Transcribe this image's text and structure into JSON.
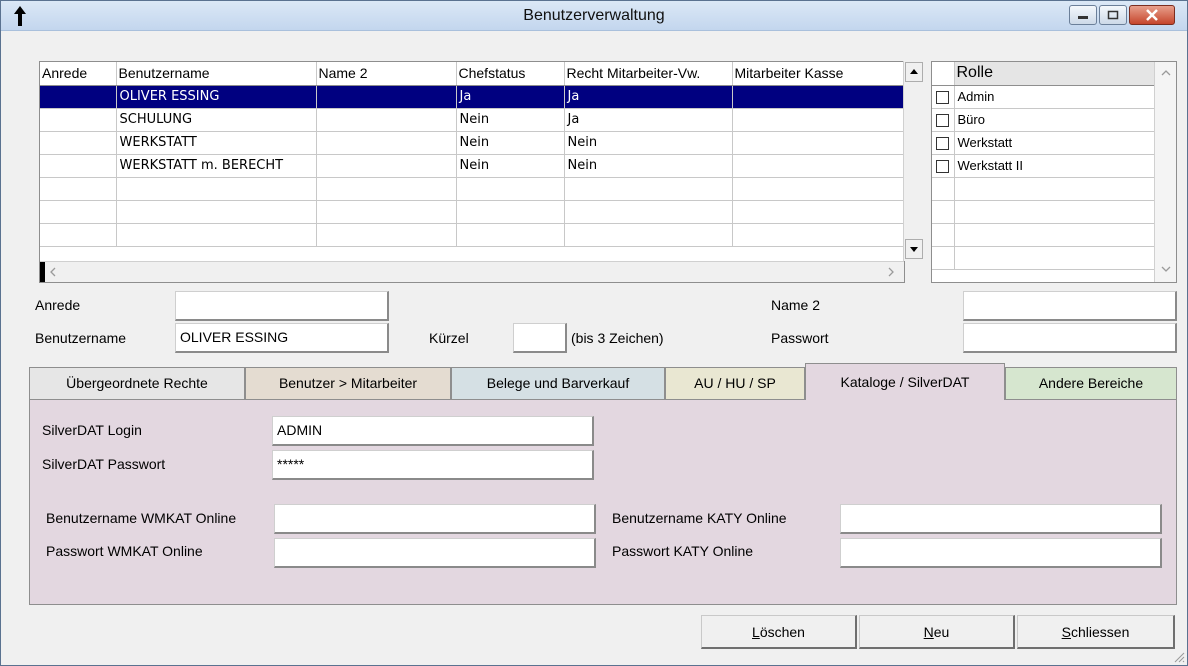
{
  "window": {
    "title": "Benutzerverwaltung"
  },
  "user_grid": {
    "columns": [
      "Anrede",
      "Benutzername",
      "Name 2",
      "Chefstatus",
      "Recht Mitarbeiter-Vw.",
      "Mitarbeiter Kasse"
    ],
    "rows": [
      [
        "",
        "OLIVER ESSING",
        "",
        "Ja",
        "Ja",
        ""
      ],
      [
        "",
        "SCHULUNG",
        "",
        "Nein",
        "Ja",
        ""
      ],
      [
        "",
        "WERKSTATT",
        "",
        "Nein",
        "Nein",
        ""
      ],
      [
        "",
        "WERKSTATT m. BERECHT",
        "",
        "Nein",
        "Nein",
        ""
      ]
    ],
    "selected_row": 0
  },
  "role_grid": {
    "header": "Rolle",
    "roles": [
      "Admin",
      "Büro",
      "Werkstatt",
      "Werkstatt II"
    ]
  },
  "form": {
    "anrede_label": "Anrede",
    "anrede_value": "",
    "benutzername_label": "Benutzername",
    "benutzername_value": "OLIVER ESSING",
    "kuerzel_label": "Kürzel",
    "kuerzel_value": "",
    "kuerzel_hint": "(bis 3 Zeichen)",
    "name2_label": "Name 2",
    "name2_value": "",
    "passwort_label": "Passwort",
    "passwort_value": ""
  },
  "tabs": {
    "t1": "Übergeordnete Rechte",
    "t2": "Benutzer > Mitarbeiter",
    "t3": "Belege und Barverkauf",
    "t4": "AU / HU / SP",
    "t5": "Kataloge / SilverDAT",
    "t6": "Andere Bereiche",
    "active": "Kataloge / SilverDAT",
    "colors": {
      "t1": "#e6e6e6",
      "t2": "#e4dcd1",
      "t3": "#d5e0e4",
      "t4": "#e9e7d2",
      "t5": "#e3d7e0",
      "t6": "#d6e6cf"
    }
  },
  "panel": {
    "silverdat_login_label": "SilverDAT Login",
    "silverdat_login_value": "ADMIN",
    "silverdat_passwort_label": "SilverDAT Passwort",
    "silverdat_passwort_value": "*****",
    "wmkat_user_label": "Benutzername WMKAT Online",
    "wmkat_user_value": "",
    "wmkat_pass_label": "Passwort WMKAT Online",
    "wmkat_pass_value": "",
    "katy_user_label": "Benutzername KATY Online",
    "katy_user_value": "",
    "katy_pass_label": "Passwort KATY Online",
    "katy_pass_value": ""
  },
  "buttons": {
    "loeschen_first": "L",
    "loeschen_rest": "öschen",
    "neu_first": "N",
    "neu_rest": "eu",
    "schliessen_first": "S",
    "schliessen_rest": "chliessen"
  },
  "icons": {
    "app": "pin-icon",
    "minimize": "minimize-icon",
    "maximize": "maximize-icon",
    "close": "close-icon"
  }
}
